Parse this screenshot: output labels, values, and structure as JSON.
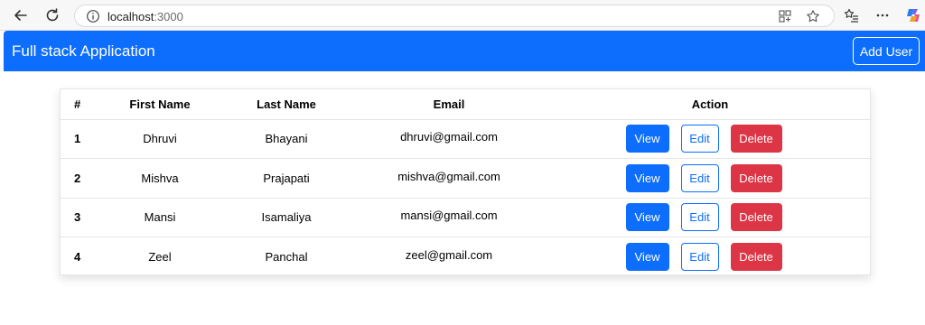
{
  "browser": {
    "address_host": "localhost",
    "address_port": ":3000"
  },
  "navbar": {
    "brand": "Full stack Application",
    "add_user_label": "Add User",
    "color": "#0d6efd"
  },
  "table": {
    "headers": [
      "#",
      "First Name",
      "Last Name",
      "Email",
      "Action"
    ],
    "rows": [
      {
        "id": "1",
        "first": "Dhruvi",
        "last": "Bhayani",
        "email": "dhruvi@gmail.com"
      },
      {
        "id": "2",
        "first": "Mishva",
        "last": "Prajapati",
        "email": "mishva@gmail.com"
      },
      {
        "id": "3",
        "first": "Mansi",
        "last": "Isamaliya",
        "email": "mansi@gmail.com"
      },
      {
        "id": "4",
        "first": "Zeel",
        "last": "Panchal",
        "email": "zeel@gmail.com"
      }
    ],
    "actions": {
      "view": "View",
      "edit": "Edit",
      "delete": "Delete"
    }
  },
  "colors": {
    "primary": "#0d6efd",
    "danger": "#dc3545"
  },
  "icons": [
    "back-arrow-icon",
    "reload-icon",
    "info-icon",
    "extensions-icon",
    "favorite-star-icon",
    "favorites-list-icon",
    "more-menu-icon",
    "copilot-icon"
  ]
}
